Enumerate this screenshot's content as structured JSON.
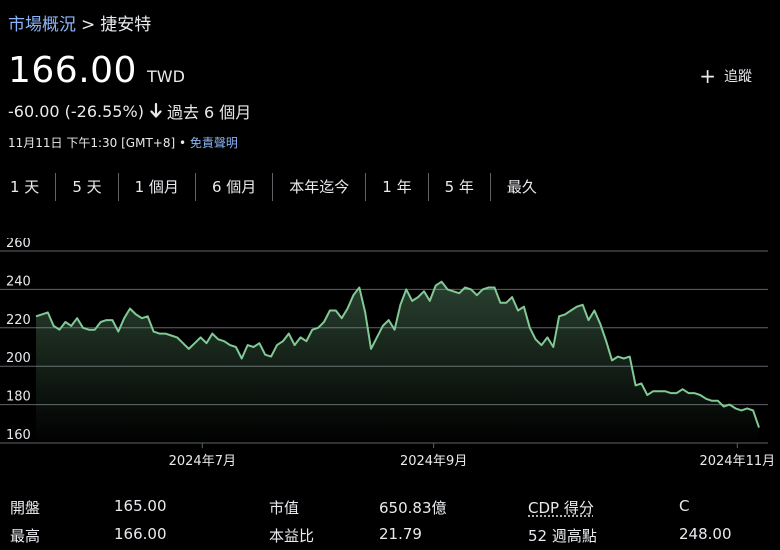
{
  "breadcrumb": {
    "market": "市場概況",
    "separator": ">",
    "current": "捷安特"
  },
  "quote": {
    "price": "166.00",
    "currency": "TWD",
    "change": "-60.00 (-26.55%)",
    "period": "過去 6 個月",
    "timestamp": "11月11日 下午1:30 [GMT+8]",
    "disclaimer": "免責聲明",
    "bullet": "•"
  },
  "follow": {
    "label": "追蹤"
  },
  "ranges": [
    "1 天",
    "5 天",
    "1 個月",
    "6 個月",
    "本年迄今",
    "1 年",
    "5 年",
    "最久"
  ],
  "colors": {
    "line": "#81c995",
    "link": "#8ab4f8",
    "grid": "#5f6368"
  },
  "stats": {
    "open": {
      "label": "開盤",
      "value": "165.00"
    },
    "high": {
      "label": "最高",
      "value": "166.00"
    },
    "mktcap": {
      "label": "市值",
      "value": "650.83億"
    },
    "pe": {
      "label": "本益比",
      "value": "21.79"
    },
    "cdp": {
      "label": "CDP 得分",
      "value": "C"
    },
    "wk52high": {
      "label": "52 週高點",
      "value": "248.00"
    }
  },
  "chart_data": {
    "type": "area",
    "ylim": [
      160,
      260
    ],
    "yticks": [
      160,
      180,
      200,
      220,
      240,
      260
    ],
    "x_range": [
      0,
      100
    ],
    "x_ticks": [
      {
        "label": "2024年7月",
        "pos": 23
      },
      {
        "label": "2024年9月",
        "pos": 55
      },
      {
        "label": "2024年11月",
        "pos": 97
      }
    ],
    "grid": true,
    "values": [
      226,
      227,
      228,
      221,
      219,
      223,
      221,
      225,
      220,
      219,
      219,
      223,
      224,
      224,
      218,
      225,
      230,
      227,
      225,
      226,
      218,
      217,
      217,
      216,
      215,
      212,
      209,
      212,
      215,
      212,
      217,
      214,
      213,
      211,
      210,
      204,
      211,
      210,
      212,
      206,
      205,
      211,
      213,
      217,
      211,
      215,
      213,
      219,
      220,
      223,
      229,
      229,
      225,
      230,
      237,
      241,
      228,
      209,
      215,
      221,
      224,
      219,
      232,
      240,
      234,
      236,
      239,
      234,
      242,
      244,
      240,
      239,
      238,
      241,
      240,
      237,
      240,
      241,
      241,
      233,
      233,
      236,
      229,
      231,
      220,
      214,
      211,
      215,
      210,
      226,
      227,
      229,
      231,
      232,
      224,
      229,
      222,
      213,
      203,
      205,
      204,
      205,
      190,
      191,
      185,
      187,
      187,
      187,
      186,
      186,
      188,
      186,
      186,
      185,
      183,
      182,
      182,
      179,
      180,
      178,
      177,
      178,
      177,
      168
    ]
  }
}
